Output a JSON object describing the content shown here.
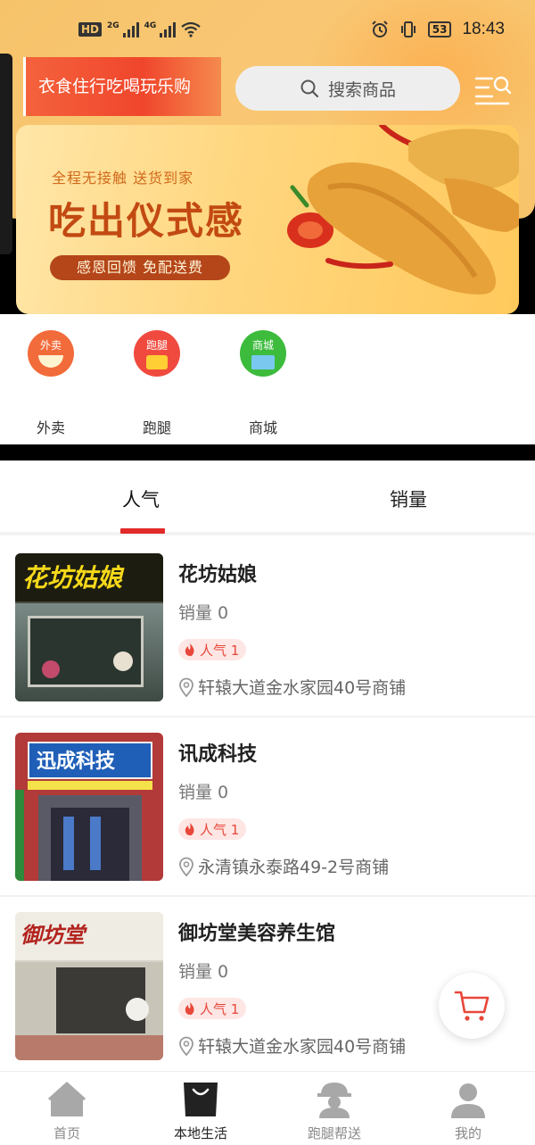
{
  "status_bar": {
    "hd": "HD",
    "net1": "2G",
    "net2": "4G",
    "battery": "53",
    "time": "18:43"
  },
  "header": {
    "slogan": "衣食住行吃喝玩乐购",
    "search_placeholder": "搜索商品",
    "menu_icon": "filter-search-icon"
  },
  "banner": {
    "subtitle": "全程无接触 送货到家",
    "title": "吃出仪式感",
    "pill": "感恩回馈 免配送费"
  },
  "categories": [
    {
      "badge": "外卖",
      "label": "外卖",
      "color": "#f26b3a"
    },
    {
      "badge": "跑腿",
      "label": "跑腿",
      "color": "#f04a3e"
    },
    {
      "badge": "商城",
      "label": "商城",
      "color": "#3cbb3c"
    }
  ],
  "tabs": [
    {
      "label": "人气",
      "active": true
    },
    {
      "label": "销量",
      "active": false
    }
  ],
  "stores": [
    {
      "name": "花坊姑娘",
      "sales": "销量 0",
      "popularity": "人气 1",
      "address": "轩辕大道金水家园40号商铺",
      "sign_text": "花坊姑娘"
    },
    {
      "name": "讯成科技",
      "sales": "销量 0",
      "popularity": "人气 1",
      "address": "永清镇永泰路49-2号商铺",
      "sign_text": "迅成科技"
    },
    {
      "name": "御坊堂美容养生馆",
      "sales": "销量 0",
      "popularity": "人气 1",
      "address": "轩辕大道金水家园40号商铺",
      "sign_text": "御坊堂"
    }
  ],
  "bottom_nav": [
    {
      "label": "首页",
      "active": false
    },
    {
      "label": "本地生活",
      "active": true
    },
    {
      "label": "跑腿帮送",
      "active": false
    },
    {
      "label": "我的",
      "active": false
    }
  ],
  "colors": {
    "accent_red": "#e12a2a",
    "hero_yellow": "#f6c36a"
  }
}
